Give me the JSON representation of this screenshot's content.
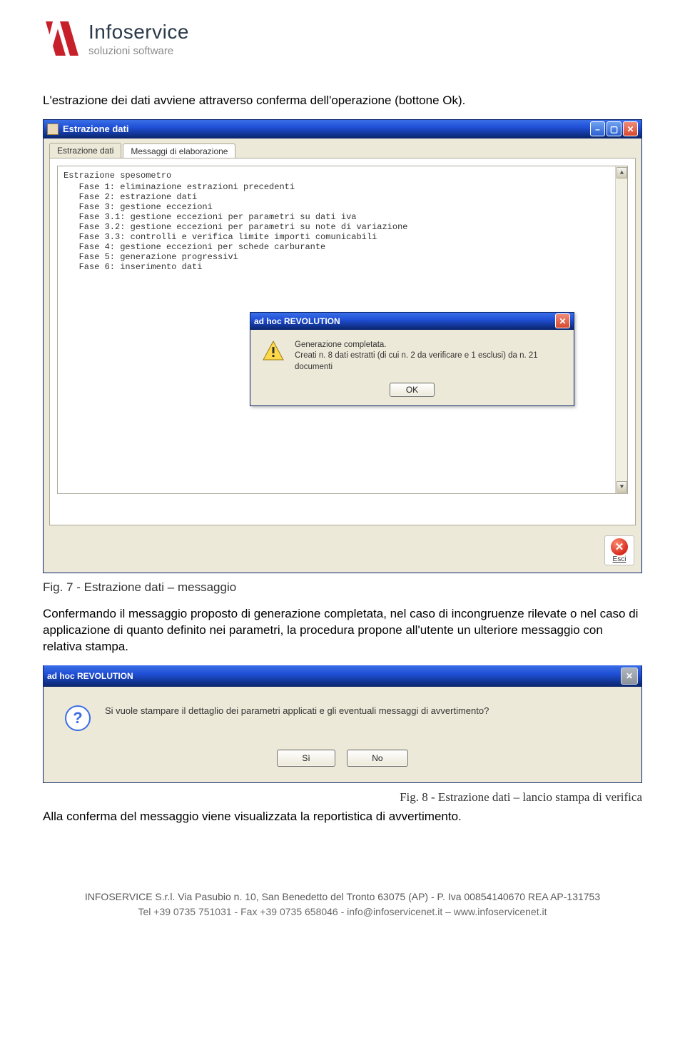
{
  "brand": {
    "name": "Infoservice",
    "subtitle": "soluzioni software"
  },
  "para1": "L'estrazione dei dati avviene attraverso conferma dell'operazione (bottone Ok).",
  "main_window": {
    "title": "Estrazione dati",
    "tabs": [
      "Estrazione dati",
      "Messaggi di elaborazione"
    ],
    "active_tab": 1,
    "console_heading": "Estrazione spesometro",
    "console_lines": [
      "   Fase 1: eliminazione estrazioni precedenti",
      "   Fase 2: estrazione dati",
      "   Fase 3: gestione eccezioni",
      "   Fase 3.1: gestione eccezioni per parametri su dati iva",
      "   Fase 3.2: gestione eccezioni per parametri su note di variazione",
      "   Fase 3.3: controlli e verifica limite importi comunicabili",
      "   Fase 4: gestione eccezioni per schede carburante",
      "   Fase 5: generazione progressivi",
      "   Fase 6: inserimento dati"
    ],
    "esci_label": "Esci"
  },
  "msg_dialog": {
    "title": "ad hoc REVOLUTION",
    "line1": "Generazione completata.",
    "line2": "Creati n. 8 dati estratti (di cui n. 2 da verificare e 1 esclusi) da n. 21 documenti",
    "ok": "OK"
  },
  "fig7": "Fig. 7 - Estrazione dati – messaggio",
  "para2": "Confermando il messaggio proposto di generazione completata, nel caso di incongruenze rilevate o nel caso di applicazione di quanto definito nei parametri, la procedura propone all'utente un ulteriore messaggio con relativa stampa.",
  "print_dialog": {
    "title": "ad hoc REVOLUTION",
    "text": "Si vuole stampare il dettaglio dei parametri applicati e gli eventuali messaggi di avvertimento?",
    "yes": "Sì",
    "no": "No"
  },
  "fig8": "Fig. 8 - Estrazione dati – lancio stampa di verifica",
  "para3": "Alla conferma del messaggio viene visualizzata la reportistica di avvertimento.",
  "footer": {
    "line1": "INFOSERVICE S.r.l. Via Pasubio n. 10, San Benedetto del Tronto 63075 (AP) - P. Iva 00854140670 REA AP-131753",
    "line2": "Tel +39 0735 751031 - Fax +39 0735 658046 - info@infoservicenet.it – www.infoservicenet.it"
  }
}
